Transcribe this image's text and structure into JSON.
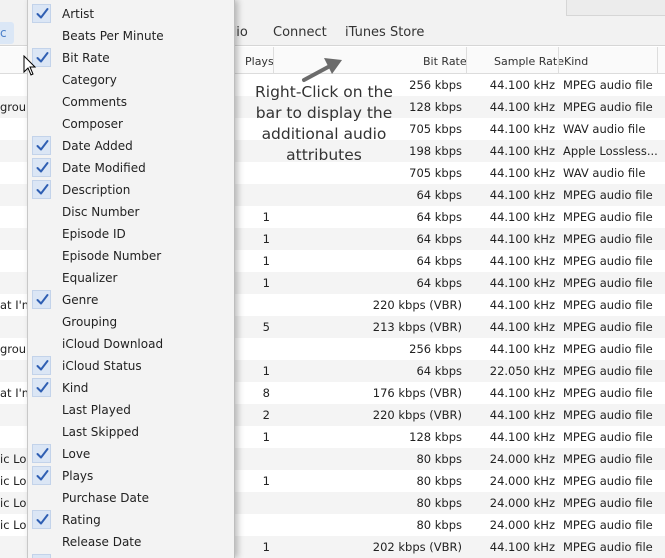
{
  "nav": {
    "left_fragment": "c",
    "items": [
      "dio",
      "Connect",
      "iTunes Store"
    ]
  },
  "columns": {
    "plays": "Plays",
    "bit_rate": "Bit Rate",
    "sample_rate": "Sample Rate",
    "kind": "Kind"
  },
  "annotation": "Right-Click on the bar to display the additional audio attributes",
  "menu": {
    "items": [
      {
        "label": "Artist",
        "checked": true
      },
      {
        "label": "Beats Per Minute",
        "checked": false
      },
      {
        "label": "Bit Rate",
        "checked": true
      },
      {
        "label": "Category",
        "checked": false
      },
      {
        "label": "Comments",
        "checked": false
      },
      {
        "label": "Composer",
        "checked": false
      },
      {
        "label": "Date Added",
        "checked": true
      },
      {
        "label": "Date Modified",
        "checked": true
      },
      {
        "label": "Description",
        "checked": true
      },
      {
        "label": "Disc Number",
        "checked": false
      },
      {
        "label": "Episode ID",
        "checked": false
      },
      {
        "label": "Episode Number",
        "checked": false
      },
      {
        "label": "Equalizer",
        "checked": false
      },
      {
        "label": "Genre",
        "checked": true
      },
      {
        "label": "Grouping",
        "checked": false
      },
      {
        "label": "iCloud Download",
        "checked": false
      },
      {
        "label": "iCloud Status",
        "checked": true
      },
      {
        "label": "Kind",
        "checked": true
      },
      {
        "label": "Last Played",
        "checked": false
      },
      {
        "label": "Last Skipped",
        "checked": false
      },
      {
        "label": "Love",
        "checked": true
      },
      {
        "label": "Plays",
        "checked": true
      },
      {
        "label": "Purchase Date",
        "checked": false
      },
      {
        "label": "Rating",
        "checked": true
      },
      {
        "label": "Release Date",
        "checked": false
      }
    ]
  },
  "rows": [
    {
      "name": "",
      "plays": "",
      "bit_rate": "256 kbps",
      "sample_rate": "44.100 kHz",
      "kind": "MPEG audio file"
    },
    {
      "name": "grou",
      "plays": "",
      "bit_rate": "128 kbps",
      "sample_rate": "44.100 kHz",
      "kind": "MPEG audio file"
    },
    {
      "name": "",
      "plays": "",
      "bit_rate": "705 kbps",
      "sample_rate": "44.100 kHz",
      "kind": "WAV audio file"
    },
    {
      "name": "",
      "plays": "",
      "bit_rate": "198 kbps",
      "sample_rate": "44.100 kHz",
      "kind": "Apple Lossless..."
    },
    {
      "name": "",
      "plays": "",
      "bit_rate": "705 kbps",
      "sample_rate": "44.100 kHz",
      "kind": "WAV audio file"
    },
    {
      "name": "",
      "plays": "",
      "bit_rate": "64 kbps",
      "sample_rate": "44.100 kHz",
      "kind": "MPEG audio file"
    },
    {
      "name": "",
      "plays": "1",
      "bit_rate": "64 kbps",
      "sample_rate": "44.100 kHz",
      "kind": "MPEG audio file"
    },
    {
      "name": "",
      "plays": "1",
      "bit_rate": "64 kbps",
      "sample_rate": "44.100 kHz",
      "kind": "MPEG audio file"
    },
    {
      "name": "",
      "plays": "1",
      "bit_rate": "64 kbps",
      "sample_rate": "44.100 kHz",
      "kind": "MPEG audio file"
    },
    {
      "name": "",
      "plays": "1",
      "bit_rate": "64 kbps",
      "sample_rate": "44.100 kHz",
      "kind": "MPEG audio file"
    },
    {
      "name": "at I'm",
      "plays": "",
      "bit_rate": "220 kbps (VBR)",
      "sample_rate": "44.100 kHz",
      "kind": "MPEG audio file"
    },
    {
      "name": "",
      "plays": "5",
      "bit_rate": "213 kbps (VBR)",
      "sample_rate": "44.100 kHz",
      "kind": "MPEG audio file"
    },
    {
      "name": "grou",
      "plays": "",
      "bit_rate": "256 kbps",
      "sample_rate": "44.100 kHz",
      "kind": "MPEG audio file"
    },
    {
      "name": "",
      "plays": "1",
      "bit_rate": "64 kbps",
      "sample_rate": "22.050 kHz",
      "kind": "MPEG audio file"
    },
    {
      "name": "at I'm",
      "plays": "8",
      "bit_rate": "176 kbps (VBR)",
      "sample_rate": "44.100 kHz",
      "kind": "MPEG audio file"
    },
    {
      "name": "",
      "plays": "2",
      "bit_rate": "220 kbps (VBR)",
      "sample_rate": "44.100 kHz",
      "kind": "MPEG audio file"
    },
    {
      "name": "",
      "plays": "1",
      "bit_rate": "128 kbps",
      "sample_rate": "44.100 kHz",
      "kind": "MPEG audio file"
    },
    {
      "name": "ic Lo",
      "plays": "",
      "bit_rate": "80 kbps",
      "sample_rate": "24.000 kHz",
      "kind": "MPEG audio file"
    },
    {
      "name": "ic Lo",
      "plays": "1",
      "bit_rate": "80 kbps",
      "sample_rate": "24.000 kHz",
      "kind": "MPEG audio file"
    },
    {
      "name": "ic Lo",
      "plays": "",
      "bit_rate": "80 kbps",
      "sample_rate": "24.000 kHz",
      "kind": "MPEG audio file"
    },
    {
      "name": "ic Lo",
      "plays": "",
      "bit_rate": "80 kbps",
      "sample_rate": "24.000 kHz",
      "kind": "MPEG audio file"
    },
    {
      "name": "",
      "plays": "1",
      "bit_rate": "202 kbps (VBR)",
      "sample_rate": "44.100 kHz",
      "kind": "MPEG audio file"
    }
  ]
}
